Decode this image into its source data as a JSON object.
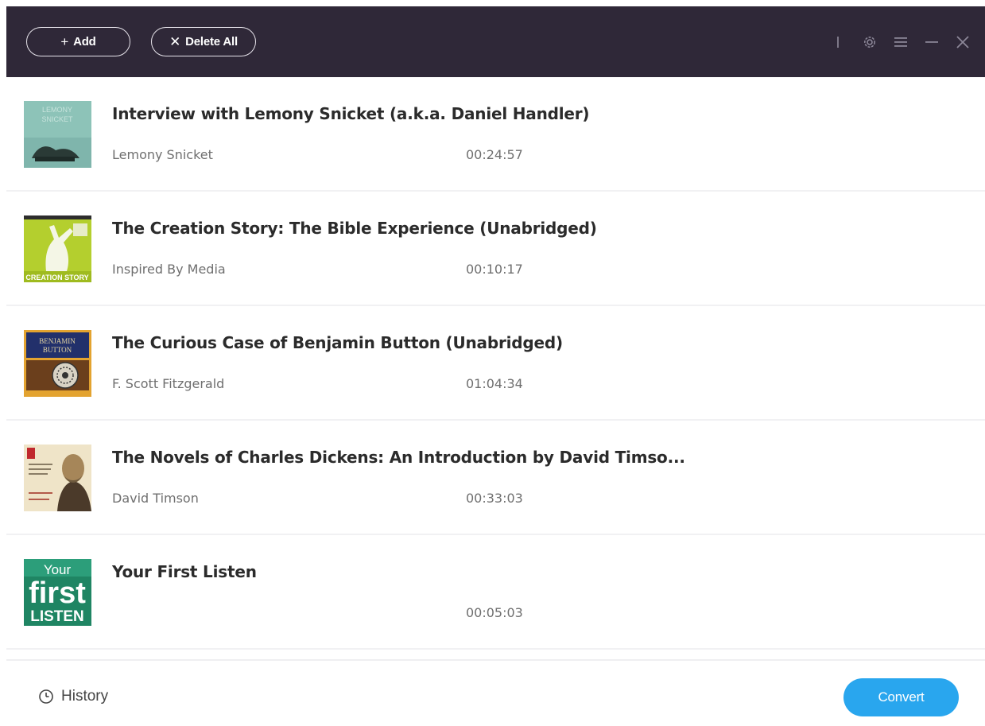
{
  "toolbar": {
    "add_label": "Add",
    "add_icon": "plus-icon",
    "delete_all_label": "Delete All",
    "delete_icon": "x-icon"
  },
  "window_controls": [
    "gear-icon",
    "menu-icon",
    "minimize-icon",
    "close-icon"
  ],
  "books": [
    {
      "title": "Interview with Lemony Snicket (a.k.a. Daniel Handler)",
      "author": "Lemony Snicket",
      "duration": "00:24:57",
      "cover_lines": [
        "LEMONY",
        "SNICKET"
      ]
    },
    {
      "title": "The Creation Story: The Bible Experience (Unabridged)",
      "author": "Inspired By Media",
      "duration": "00:10:17",
      "cover_lines": [
        "CREATION STORY"
      ]
    },
    {
      "title": "The Curious Case of Benjamin Button (Unabridged)",
      "author": "F. Scott Fitzgerald",
      "duration": "01:04:34",
      "cover_lines": [
        "BENJAMIN",
        "BUTTON"
      ]
    },
    {
      "title": "The Novels of Charles Dickens: An Introduction by David Timso...",
      "author": "David Timson",
      "duration": "00:33:03",
      "cover_lines": []
    },
    {
      "title": "Your First Listen",
      "author": "",
      "duration": "00:05:03",
      "cover_lines": [
        "Your",
        "first",
        "LISTEN"
      ]
    }
  ],
  "footer": {
    "history_label": "History",
    "history_icon": "clock-icon",
    "convert_label": "Convert"
  },
  "colors": {
    "titlebar": "#2f2838",
    "accent": "#29a6ee"
  }
}
